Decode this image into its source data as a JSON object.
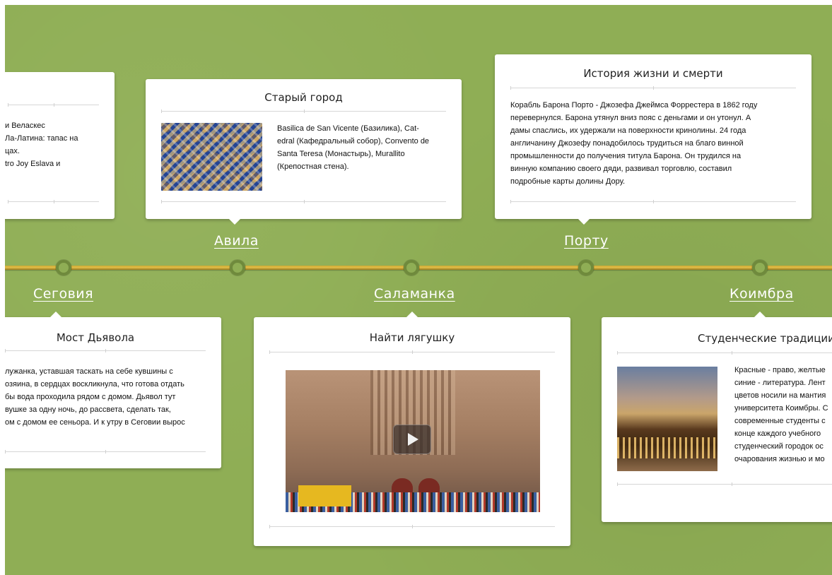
{
  "timeline": {
    "cities_top": [
      "Авила",
      "Порту"
    ],
    "cities_bottom": [
      "Сеговия",
      "Саламанка",
      "Коимбра"
    ]
  },
  "cards": {
    "madrid": {
      "title": "",
      "lines": [
        "и Веласкес",
        "Ла-Латина: тапас на",
        "цах.",
        "tro Joy Eslava  и"
      ]
    },
    "avila": {
      "title": "Старый город",
      "lines": [
        "Basilica de San Vicente (Базилика), Cat-",
        "edral (Кафедральный собор), Convento de",
        "Santa Teresa (Монастырь), Murallito",
        "(Крепостная стена)."
      ]
    },
    "porto": {
      "title": "История жизни и смерти",
      "lines": [
        "Корабль Барона Порто - Джозефа Джеймса Форрестера в 1862 году",
        "перевернулся. Барона утянул вниз пояс с деньгами и он утонул. А",
        "дамы спаслись, их удержали на поверхности кринолины. 24 года",
        "англичанину Джозефу понадобилось трудиться на благо винной",
        "промышленности до получения титула Барона. Он трудился на",
        "винную компанию своего дяди, развивал торговлю, составил",
        "подробные карты долины Дору."
      ]
    },
    "segovia": {
      "title": "Мост Дьявола",
      "lines": [
        "лужанка, уставшая таскать на себе кувшины с",
        "озяина, в сердцах воскликнула, что готова отдать",
        "бы вода проходила рядом с домом. Дьявол тут",
        "вушке за одну ночь, до рассвета, сделать так,",
        "ом с домом ее сеньора. И к утру в Сеговии вырос"
      ]
    },
    "salamanca": {
      "title": "Найти лягушку"
    },
    "coimbra": {
      "title": "Студенческие традиции",
      "lines": [
        "Красные - право, желтые",
        "синие - литература. Лент",
        "цветов носили на мантия",
        "университета Коимбры. С",
        "современные студенты с",
        "конце каждого учебного",
        "студенческий городок ос",
        "очарования жизнью и мо"
      ]
    }
  }
}
